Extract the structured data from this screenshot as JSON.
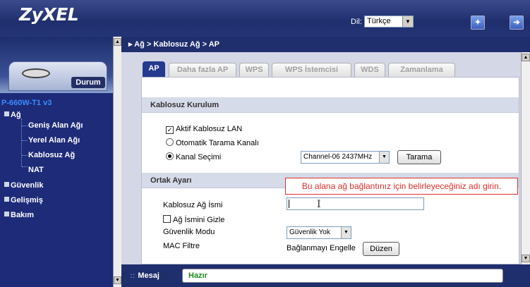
{
  "header": {
    "logo": "ZyXEL",
    "language_label": "Dil:",
    "language_value": "Türkçe",
    "wizard_icon": "wizard-icon",
    "logout_icon": "logout-icon"
  },
  "sidebar": {
    "status_button": "Durum",
    "model": "P-660W-T1 v3",
    "items": [
      {
        "label": "Ağ",
        "children": [
          "Geniş Alan Ağı",
          "Yerel Alan Ağı",
          "Kablosuz Ağ",
          "NAT"
        ]
      },
      {
        "label": "Güvenlik"
      },
      {
        "label": "Gelişmiş"
      },
      {
        "label": "Bakım"
      }
    ]
  },
  "breadcrumb": "Ağ > Kablosuz Ağ > AP",
  "tabs": [
    "AP",
    "Daha fazla AP",
    "WPS",
    "WPS İstemcisi",
    "WDS",
    "Zamanlama"
  ],
  "wireless_setup": {
    "title": "Kablosuz Kurulum",
    "enable_label": "Aktif Kablosuz LAN",
    "enable_checked": true,
    "auto_scan_label": "Otomatik Tarama Kanalı",
    "channel_select_label": "Kanal Seçimi",
    "channel_value": "Channel-06 2437MHz",
    "scan_button": "Tarama"
  },
  "common": {
    "title": "Ortak Ayarı",
    "ssid_label": "Kablosuz Ağ İsmi",
    "ssid_value": "",
    "hide_ssid_label": "Ağ İsmini Gizle",
    "security_label": "Güvenlik Modu",
    "security_value": "Güvenlik Yok",
    "mac_filter_label": "MAC Filtre",
    "mac_filter_value": "Bağlanmayı Engelle",
    "edit_button": "Düzen"
  },
  "callout": "Bu alana ağ bağlantınız için belirleyeceğiniz adı girin.",
  "status": {
    "label": "Mesaj",
    "text": "Hazır"
  }
}
